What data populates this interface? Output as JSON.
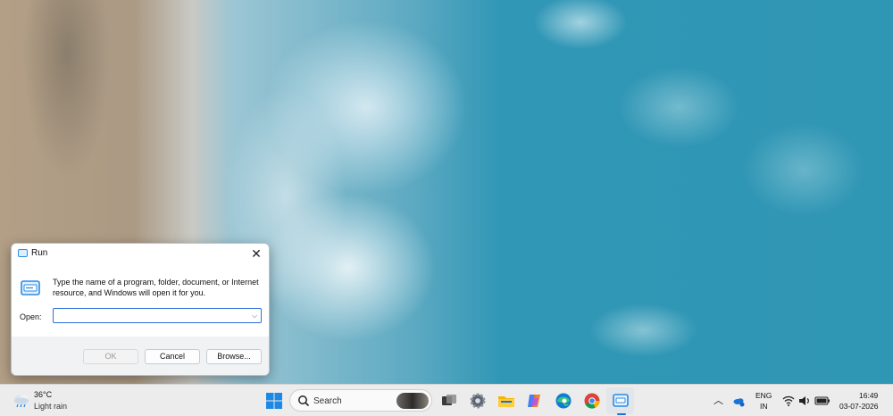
{
  "run_dialog": {
    "title": "Run",
    "description": "Type the name of a program, folder, document, or Internet resource, and Windows will open it for you.",
    "open_label": "Open:",
    "open_value": "",
    "buttons": {
      "ok": "OK",
      "cancel": "Cancel",
      "browse": "Browse..."
    }
  },
  "taskbar": {
    "weather": {
      "temperature": "36°C",
      "condition": "Light rain"
    },
    "search": {
      "placeholder": "Search"
    },
    "apps": [
      {
        "icon": "task-view-icon"
      },
      {
        "icon": "settings-icon"
      },
      {
        "icon": "file-explorer-icon"
      },
      {
        "icon": "copilot-icon"
      },
      {
        "icon": "edge-icon"
      },
      {
        "icon": "chrome-icon"
      },
      {
        "icon": "run-app-icon",
        "active": true
      }
    ],
    "tray": {
      "language_line1": "ENG",
      "language_line2": "IN",
      "time": "16:49",
      "date": "03-07-2026"
    }
  },
  "colors": {
    "accent": "#1a73d9",
    "taskbar": "#ececec"
  }
}
